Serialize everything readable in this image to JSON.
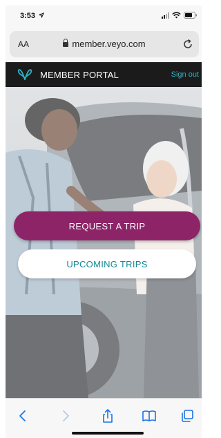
{
  "status_bar": {
    "time": "3:53"
  },
  "browser": {
    "text_size_label": "AA",
    "url": "member.veyo.com"
  },
  "portal": {
    "title": "MEMBER PORTAL",
    "sign_out_label": "Sign out"
  },
  "actions": {
    "request_trip_label": "REQUEST A TRIP",
    "upcoming_trips_label": "UPCOMING TRIPS"
  },
  "colors": {
    "header_bg": "#1b1b1b",
    "accent_teal": "#2fb3c4",
    "primary_button": "#8e2468",
    "secondary_text": "#13889a",
    "ios_blue": "#1a73e8"
  },
  "icons": {
    "location": "location-arrow-icon",
    "lock": "lock-icon",
    "reload": "reload-icon",
    "logo": "veyo-logo-icon",
    "back": "chevron-left-icon",
    "forward": "chevron-right-icon",
    "share": "share-icon",
    "bookmarks": "book-icon",
    "tabs": "tabs-icon"
  }
}
